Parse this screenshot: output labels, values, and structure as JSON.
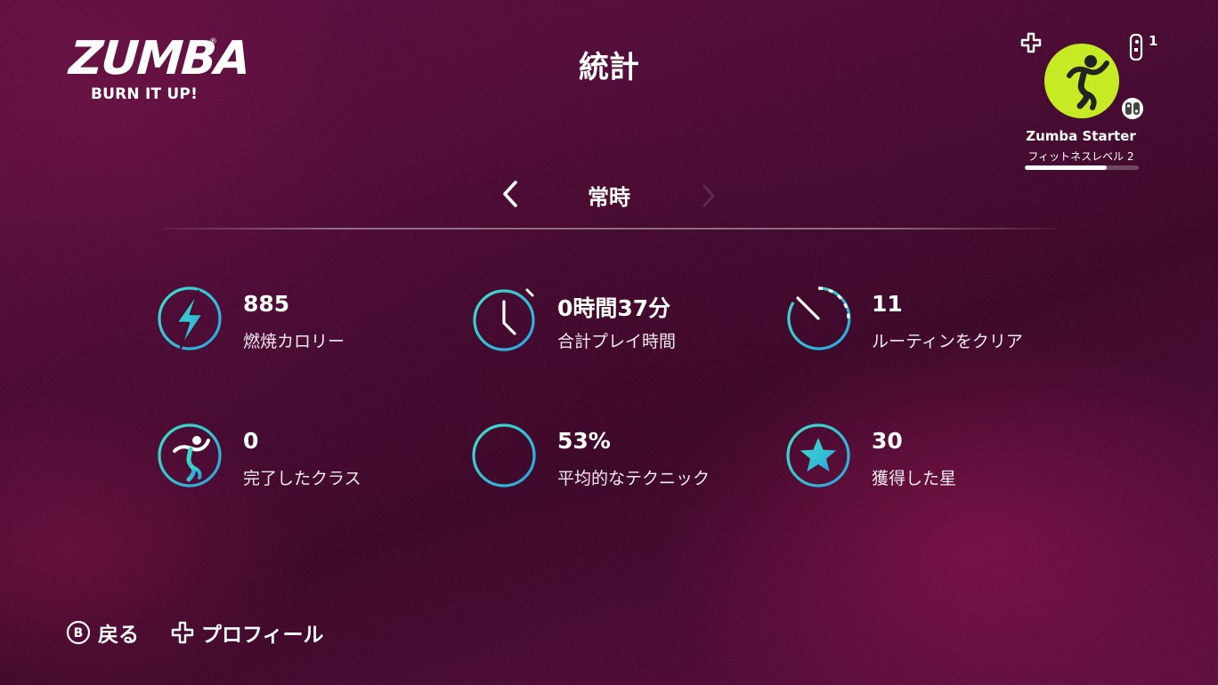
{
  "header": {
    "logo_word": "ZUMBA",
    "logo_tagline": "BURN IT UP!",
    "logo_reg": "®",
    "title": "統計"
  },
  "profile": {
    "player_number": "1",
    "name": "Zumba Starter",
    "level_label": "フィットネスレベル 2",
    "level_progress": 0.72,
    "avatar_color": "#c6ea24",
    "icons": [
      "plus-icon",
      "joycon-icon",
      "dancer-avatar-icon",
      "switch-icon"
    ]
  },
  "period": {
    "label": "常時",
    "prev_icon": "chevron-left-icon",
    "next_icon": "chevron-right-icon"
  },
  "stats": [
    {
      "value": "885",
      "label": "燃焼カロリー",
      "icon": "lightning-icon"
    },
    {
      "value": "0時間37分",
      "label": "合計プレイ時間",
      "icon": "stopwatch-icon"
    },
    {
      "value": "11",
      "label": "ルーティンをクリア",
      "icon": "timer-icon"
    },
    {
      "value": "0",
      "label": "完了したクラス",
      "icon": "dancer-icon"
    },
    {
      "value": "53%",
      "label": "平均的なテクニック",
      "icon": "bar-chart-icon"
    },
    {
      "value": "30",
      "label": "獲得した星",
      "icon": "star-icon"
    }
  ],
  "footer": {
    "back_button_glyph": "B",
    "back_label": "戻る",
    "profile_label": "プロフィール"
  },
  "colors": {
    "accent_gradient_start": "#3fe0c5",
    "accent_gradient_end": "#2aa3e0",
    "avatar": "#c6ea24"
  }
}
